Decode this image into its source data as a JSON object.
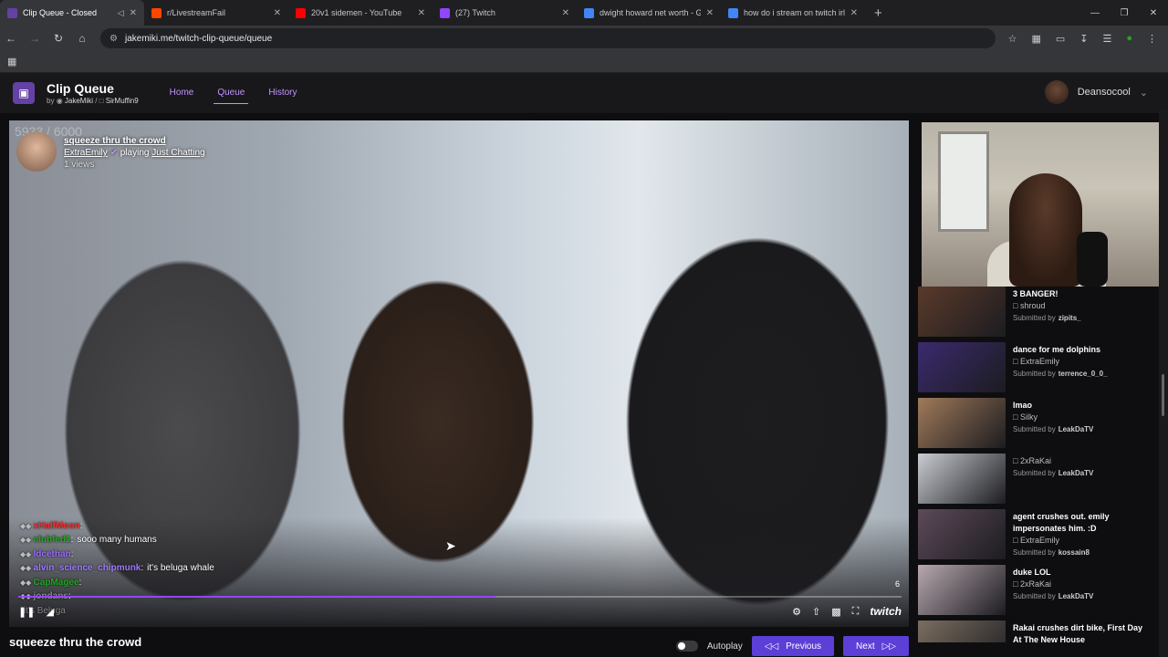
{
  "browser": {
    "tabs": [
      {
        "title": "Clip Queue - Closed",
        "color": "#6441a5",
        "active": true
      },
      {
        "title": "r/LivestreamFail",
        "color": "#ff4500",
        "active": false
      },
      {
        "title": "20v1 sidemen - YouTube",
        "color": "#ff0000",
        "active": false
      },
      {
        "title": "(27) Twitch",
        "color": "#9146ff",
        "active": false
      },
      {
        "title": "dwight howard net worth - Goo",
        "color": "#4285f4",
        "active": false
      },
      {
        "title": "how do i stream on twitch irl - G",
        "color": "#4285f4",
        "active": false
      }
    ],
    "url": "jakemiki.me/twitch-clip-queue/queue"
  },
  "app": {
    "title": "Clip Queue",
    "by": "by",
    "author1": "JakeMiki",
    "author2": "SirMuffin9",
    "nav": {
      "home": "Home",
      "queue": "Queue",
      "history": "History"
    },
    "user": "Deansocool"
  },
  "player": {
    "counter": "5933 / 6000",
    "clip_title": "squeeze thru the crowd",
    "streamer": "ExtraEmily",
    "playing": "playing",
    "category": "Just Chatting",
    "views": "1 views",
    "timecode": "6",
    "progress_fraction": 0.54,
    "chat": [
      {
        "user": "xHalfMoon",
        "sep": ":",
        "msg": "",
        "color": "#ff2a2a"
      },
      {
        "user": "clubfed1",
        "sep": ":",
        "msg": "sooo many humans",
        "color": "#1fa81f"
      },
      {
        "user": "ldcethan",
        "sep": ":",
        "msg": "",
        "color": "#9a6bff"
      },
      {
        "user": "alvin_science_chipmunk",
        "sep": ":",
        "msg": "it's beluga whale",
        "color": "#a07bff"
      },
      {
        "user": "CapMagee",
        "sep": ":",
        "msg": "",
        "color": "#1fa81f"
      },
      {
        "user": "jondans",
        "sep": ":",
        "msg": "",
        "color": "#888"
      },
      {
        "user": "",
        "sep": "",
        "msg": "it's Beluga",
        "color": "#888"
      }
    ],
    "brand": "twitch"
  },
  "below": {
    "title": "squeeze thru the crowd",
    "autoplay": "Autoplay",
    "previous": "Previous",
    "next": "Next"
  },
  "queue": [
    {
      "title": "3 BANGER!",
      "streamer": "shroud",
      "submitted": "Submitted by",
      "by": "zipits_",
      "thumb": "#5a3a2a"
    },
    {
      "title": "dance for me dolphins",
      "streamer": "ExtraEmily",
      "submitted": "Submitted by",
      "by": "terrence_0_0_",
      "thumb": "#3b2a6e"
    },
    {
      "title": "lmao",
      "streamer": "Silky",
      "submitted": "Submitted by",
      "by": "LeakDaTV",
      "thumb": "#a07a5a"
    },
    {
      "title": "",
      "streamer": "2xRaKai",
      "submitted": "Submitted by",
      "by": "LeakDaTV",
      "thumb": "#c9ccd2"
    },
    {
      "title": "agent crushes out. emily impersonates him. :D",
      "streamer": "ExtraEmily",
      "submitted": "Submitted by",
      "by": "kossain8",
      "thumb": "#5d4a5a"
    },
    {
      "title": "duke LOL",
      "streamer": "2xRaKai",
      "submitted": "Submitted by",
      "by": "LeakDaTV",
      "thumb": "#b8a8b0"
    },
    {
      "title": "Rakai crushes dirt bike, First Day At The New House",
      "streamer": "",
      "submitted": "",
      "by": "",
      "thumb": "#7a6e60"
    }
  ]
}
